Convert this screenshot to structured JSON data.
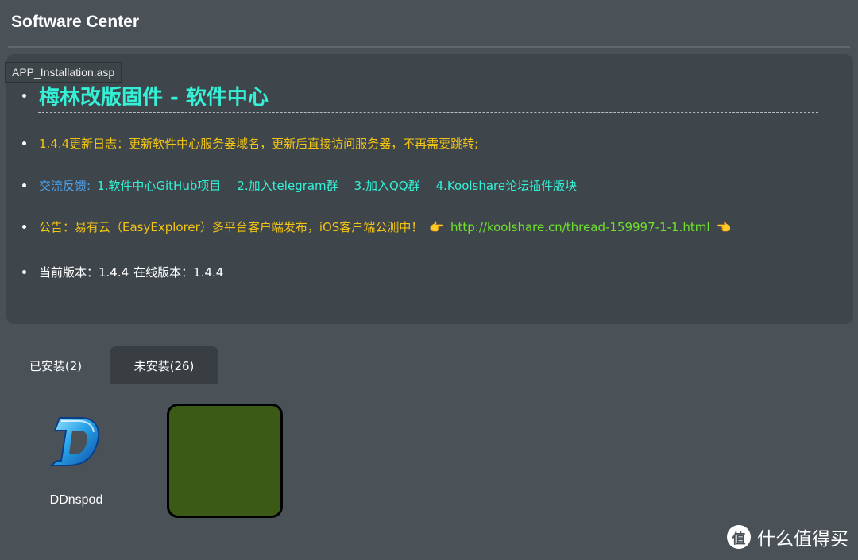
{
  "header": {
    "title": "Software Center",
    "tooltip": "APP_Installation.asp"
  },
  "info": {
    "heading": "梅林改版固件 - 软件中心",
    "log": "1.4.4更新日志：更新软件中心服务器域名，更新后直接访问服务器，不再需要跳转;",
    "feedback": {
      "label": "交流反馈:",
      "links": [
        "1.软件中心GitHub项目",
        "2.加入telegram群",
        "3.加入QQ群",
        "4.Koolshare论坛插件版块"
      ]
    },
    "notice": {
      "text": "公告：易有云（EasyExplorer）多平台客户端发布，iOS客户端公测中！",
      "link": "http://koolshare.cn/thread-159997-1-1.html",
      "pointer_right": "👉",
      "pointer_left": "👈"
    },
    "version": {
      "current": "当前版本：1.4.4",
      "online": "在线版本：1.4.4"
    }
  },
  "tabs": [
    {
      "label": "已安装(2)",
      "active": true
    },
    {
      "label": "未安装(26)",
      "active": false
    }
  ],
  "apps": [
    {
      "name": "DDnspod",
      "icon": "ddnspod-logo-icon"
    }
  ],
  "watermark": {
    "icon_glyph": "值",
    "text": "什么值得买"
  },
  "colors": {
    "background": "#4a5258",
    "panel": "#3f464b",
    "heading": "#33f0d6",
    "notice": "#f2c414",
    "feedback_label": "#4ba0ea",
    "link": "#6ee02e",
    "placeholder_tile": "#3b5a16"
  }
}
